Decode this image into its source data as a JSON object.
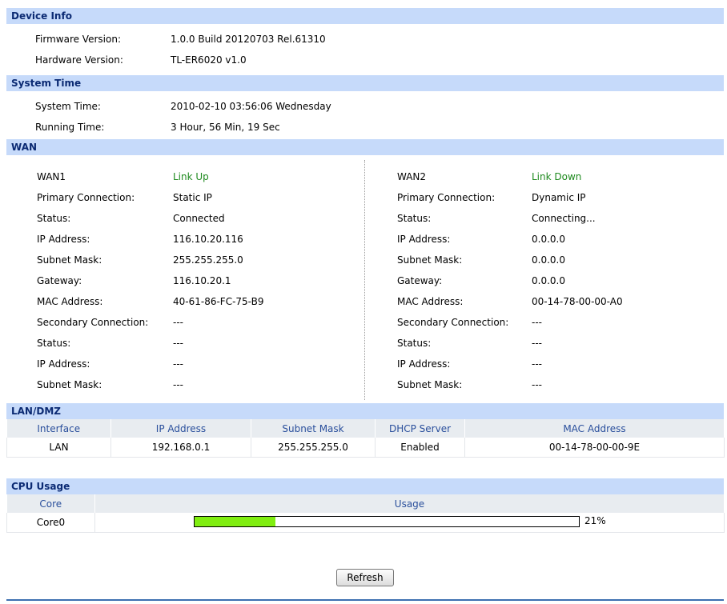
{
  "device_info": {
    "title": "Device Info",
    "firmware_label": "Firmware Version:",
    "firmware_value": "1.0.0 Build 20120703 Rel.61310",
    "hardware_label": "Hardware Version:",
    "hardware_value": "TL-ER6020 v1.0"
  },
  "system_time": {
    "title": "System Time",
    "system_time_label": "System Time:",
    "system_time_value": "2010-02-10 03:56:06 Wednesday",
    "running_time_label": "Running Time:",
    "running_time_value": "3 Hour, 56 Min, 19 Sec"
  },
  "wan": {
    "title": "WAN",
    "ports": [
      {
        "name": "WAN1",
        "link": "Link Up",
        "rows": [
          {
            "label": "Primary Connection:",
            "value": "Static IP"
          },
          {
            "label": "Status:",
            "value": "Connected"
          },
          {
            "label": "IP Address:",
            "value": "116.10.20.116"
          },
          {
            "label": "Subnet Mask:",
            "value": "255.255.255.0"
          },
          {
            "label": "Gateway:",
            "value": "116.10.20.1"
          },
          {
            "label": "MAC Address:",
            "value": "40-61-86-FC-75-B9"
          },
          {
            "label": "Secondary Connection:",
            "value": "---"
          },
          {
            "label": "Status:",
            "value": "---"
          },
          {
            "label": "IP Address:",
            "value": "---"
          },
          {
            "label": "Subnet Mask:",
            "value": "---"
          }
        ]
      },
      {
        "name": "WAN2",
        "link": "Link Down",
        "rows": [
          {
            "label": "Primary Connection:",
            "value": "Dynamic IP"
          },
          {
            "label": "Status:",
            "value": "Connecting..."
          },
          {
            "label": "IP Address:",
            "value": "0.0.0.0"
          },
          {
            "label": "Subnet Mask:",
            "value": "0.0.0.0"
          },
          {
            "label": "Gateway:",
            "value": "0.0.0.0"
          },
          {
            "label": "MAC Address:",
            "value": "00-14-78-00-00-A0"
          },
          {
            "label": "Secondary Connection:",
            "value": "---"
          },
          {
            "label": "Status:",
            "value": "---"
          },
          {
            "label": "IP Address:",
            "value": "---"
          },
          {
            "label": "Subnet Mask:",
            "value": "---"
          }
        ]
      }
    ]
  },
  "lan": {
    "title": "LAN/DMZ",
    "columns": [
      "Interface",
      "IP Address",
      "Subnet Mask",
      "DHCP Server",
      "MAC Address"
    ],
    "rows": [
      [
        "LAN",
        "192.168.0.1",
        "255.255.255.0",
        "Enabled",
        "00-14-78-00-00-9E"
      ]
    ]
  },
  "cpu": {
    "title": "CPU Usage",
    "columns": [
      "Core",
      "Usage"
    ],
    "rows": [
      {
        "core": "Core0",
        "usage_percent": 21,
        "usage_text": "21%"
      }
    ]
  },
  "actions": {
    "refresh_label": "Refresh"
  },
  "colors": {
    "section_header_bg": "#c6dafa",
    "section_header_text": "#0b2a73",
    "link_status": "#1e8a1e",
    "cpu_bar": "#80ee10",
    "table_header_text": "#2a4f9c"
  }
}
